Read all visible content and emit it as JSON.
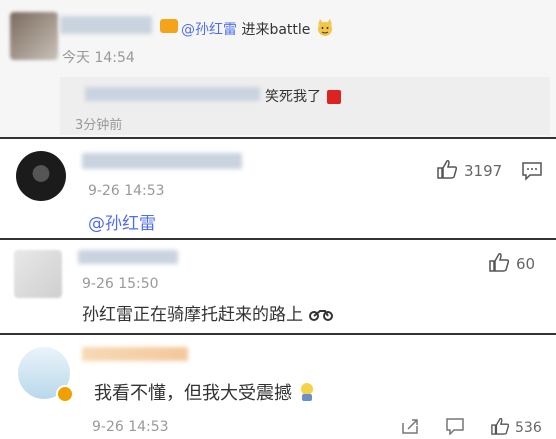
{
  "c1": {
    "mention": "@孙红雷",
    "text": " 进来battle",
    "time": "今天 14:54",
    "reply": {
      "text": "笑死我了",
      "time": "3分钟前"
    }
  },
  "c2": {
    "time": "9-26 14:53",
    "mention": "@孙红雷",
    "likes": "3197"
  },
  "c3": {
    "time": "9-26 15:50",
    "text": "孙红雷正在骑摩托赶来的路上",
    "likes": "60"
  },
  "c4": {
    "text": "我看不懂，但我大受震撼",
    "time": "9-26 14:53",
    "likes": "536"
  },
  "colors": {
    "link": "#4e6ef2",
    "time": "#999999",
    "separator": "#333333",
    "vip": "#f2a000"
  }
}
